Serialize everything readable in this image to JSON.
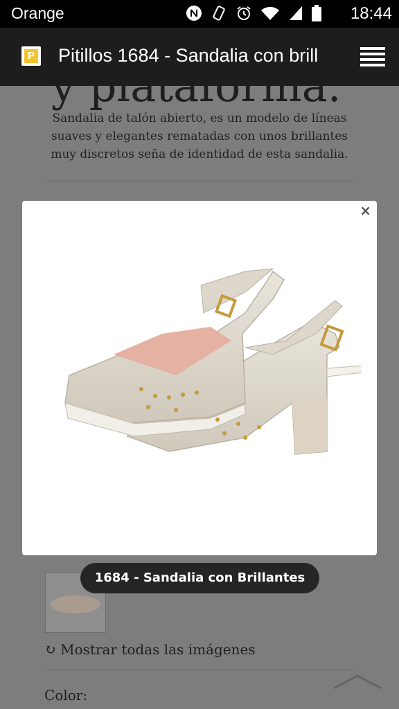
{
  "status_bar": {
    "carrier": "Orange",
    "time": "18:44",
    "icons": [
      "nfc-icon",
      "vibrate-icon",
      "alarm-icon",
      "wifi-icon",
      "signal-icon",
      "battery-icon"
    ]
  },
  "app_bar": {
    "logo_letter": "P",
    "title": "Pitillos 1684 - Sandalia con brill",
    "menu_icon": "menu-icon"
  },
  "page": {
    "heading_partial": "y plataforma.",
    "description": "Sandalia de talón abierto, es un modelo de líneas suaves y elegantes rematadas con unos brillantes muy discretos seña de identidad de esta sandalia.",
    "show_all_icon": "refresh-icon",
    "show_all_label": "Mostrar todas las imágenes",
    "color_label": "Color:"
  },
  "lightbox": {
    "close_label": "×",
    "image_subject": "beige-slingback-sandal-photo",
    "caption": "1684 - Sandalia con Brillantes"
  },
  "colors": {
    "status_bar_bg": "#000000",
    "app_bar_bg": "#1d1d1d",
    "overlay_bg": "#7d7d7d",
    "caption_bg": "#252525"
  }
}
